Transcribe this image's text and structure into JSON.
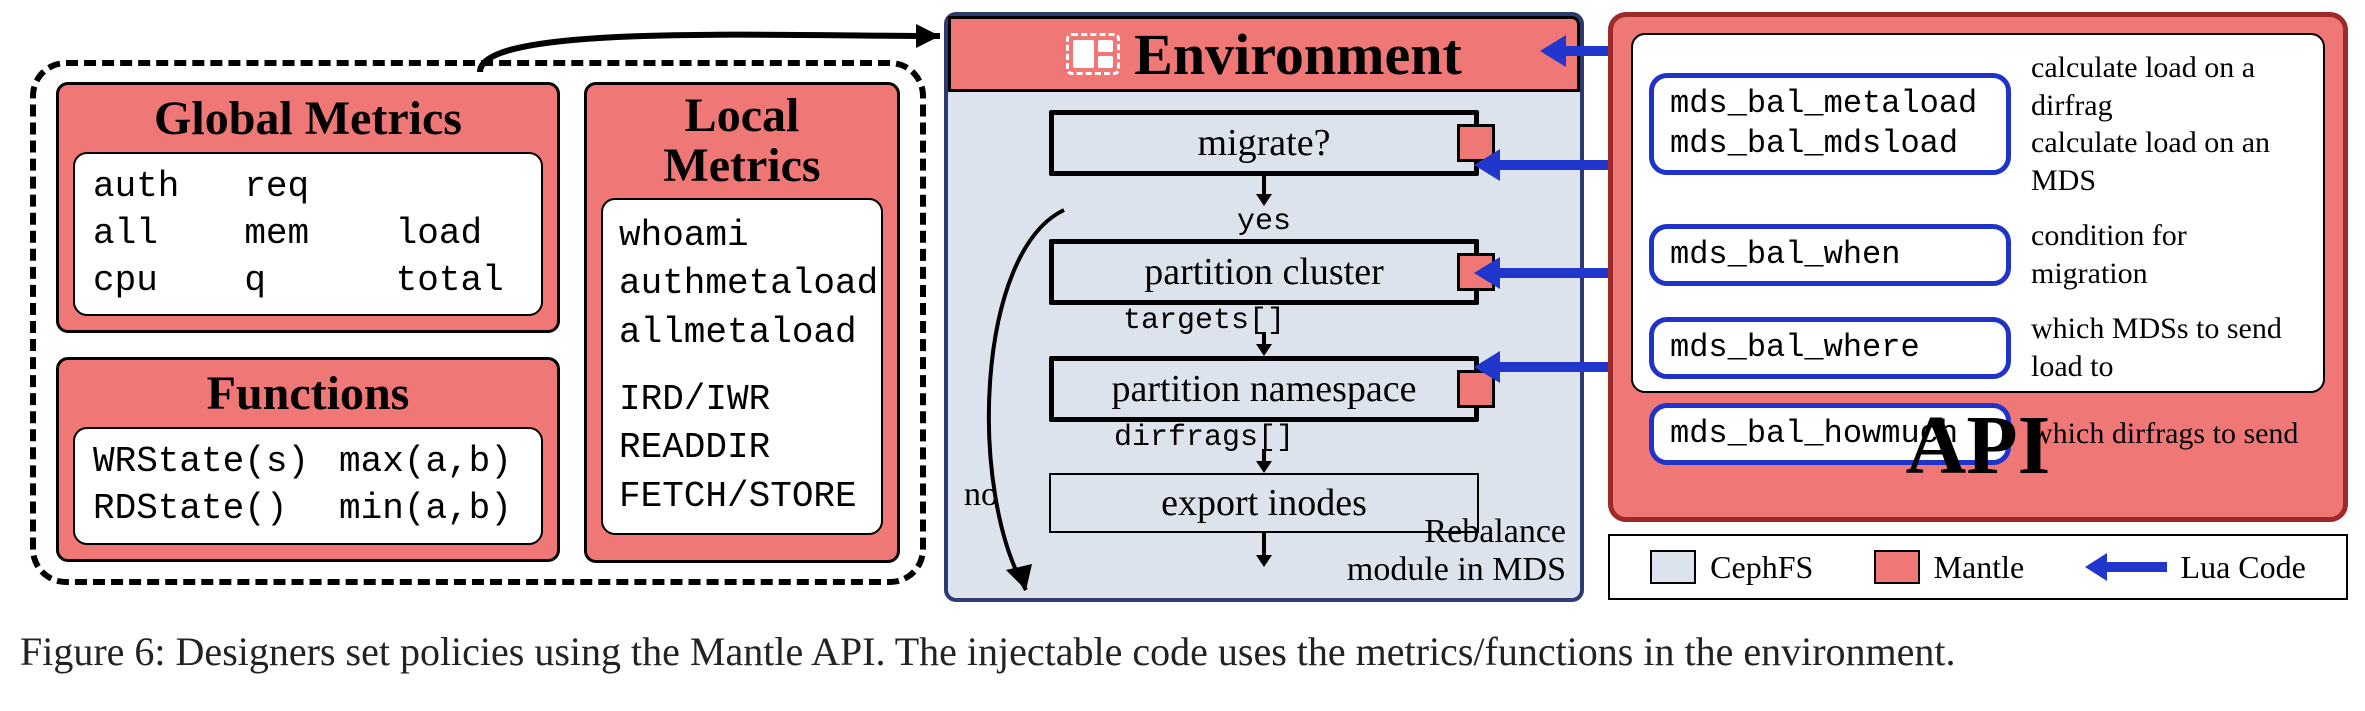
{
  "colors": {
    "mantle": "#EF7776",
    "cephfs": "#DCE3ED",
    "blue": "#2136CD",
    "darkred": "#9B2A28"
  },
  "global_metrics": {
    "title": "Global Metrics",
    "items": [
      "auth",
      "req",
      "",
      "all",
      "mem",
      "load",
      "cpu",
      "q",
      "total"
    ]
  },
  "functions": {
    "title": "Functions",
    "items": [
      "WRState(s)",
      "max(a,b)",
      "RDState()",
      "min(a,b)"
    ]
  },
  "local_metrics": {
    "title": "Local Metrics",
    "group1": [
      "whoami",
      "authmetaload",
      "allmetaload"
    ],
    "group2": [
      "IRD/IWR",
      "READDIR",
      "FETCH/STORE"
    ]
  },
  "environment": {
    "title": "Environment",
    "steps": [
      {
        "label": "migrate?",
        "out": "yes"
      },
      {
        "label": "partition cluster",
        "out": "targets[]"
      },
      {
        "label": "partition namespace",
        "out": "dirfrags[]"
      }
    ],
    "final": "export inodes",
    "no_label": "no",
    "caption_l1": "Rebalance",
    "caption_l2": "module in MDS"
  },
  "api": {
    "title": "API",
    "rows": [
      {
        "names": [
          "mds_bal_metaload",
          "mds_bal_mdsload"
        ],
        "descs": [
          "calculate load on a dirfrag",
          "calculate load on an MDS"
        ]
      },
      {
        "names": [
          "mds_bal_when"
        ],
        "descs": [
          "condition for migration"
        ]
      },
      {
        "names": [
          "mds_bal_where"
        ],
        "descs": [
          "which MDSs to send load to"
        ]
      },
      {
        "names": [
          "mds_bal_howmuch"
        ],
        "descs": [
          "which dirfrags to send"
        ]
      }
    ]
  },
  "legend": {
    "cephfs": "CephFS",
    "mantle": "Mantle",
    "lua": "Lua Code"
  },
  "caption": "Figure 6: Designers set policies using the Mantle API. The injectable code uses the metrics/functions in the environment."
}
